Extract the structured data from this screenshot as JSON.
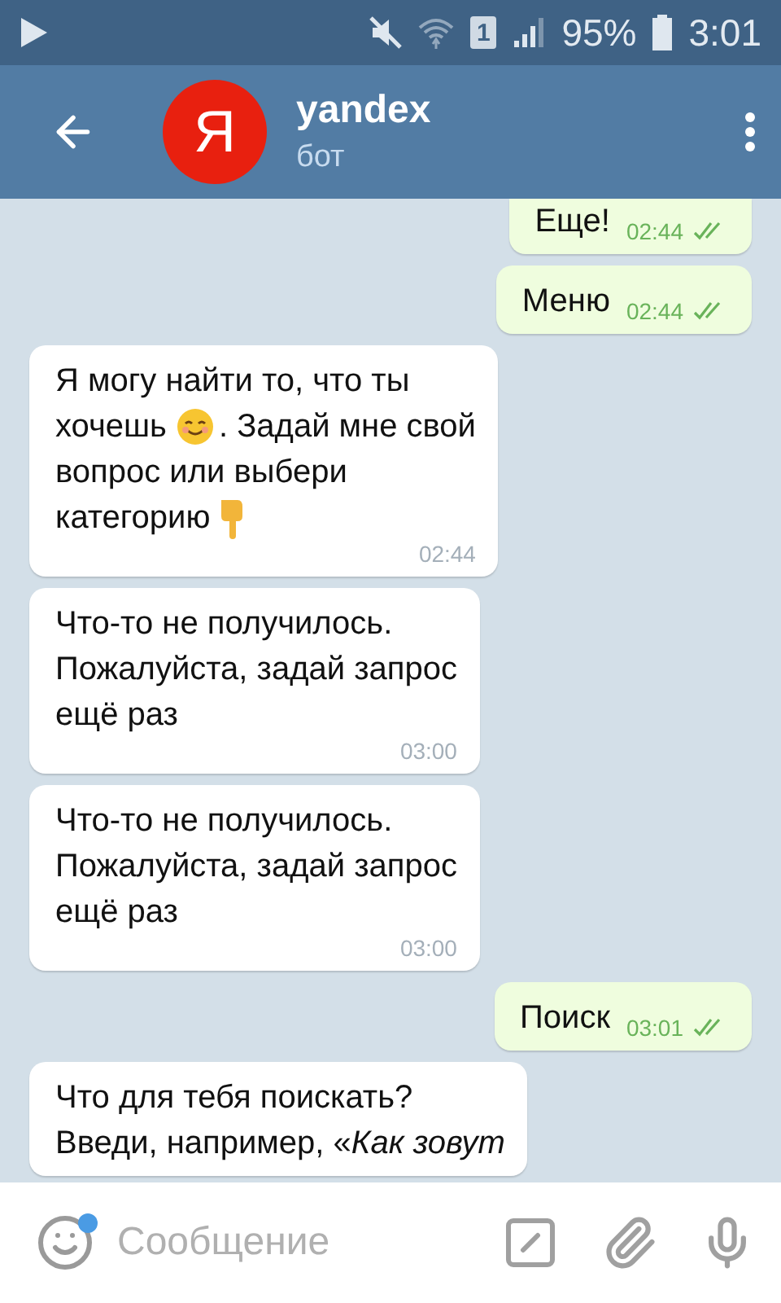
{
  "status_bar": {
    "sim": "1",
    "battery": "95%",
    "time": "3:01"
  },
  "header": {
    "avatar_letter": "Я",
    "title": "yandex",
    "subtitle": "бот"
  },
  "messages": [
    {
      "outgoing": true,
      "cut_top": true,
      "lines": [
        [
          {
            "kind": "text",
            "text": "Еще!"
          }
        ]
      ],
      "time": "02:44"
    },
    {
      "outgoing": true,
      "cut_top": false,
      "lines": [
        [
          {
            "kind": "text",
            "text": "Меню"
          }
        ]
      ],
      "time": "02:44"
    },
    {
      "outgoing": false,
      "cut_top": false,
      "lines": [
        [
          {
            "kind": "text",
            "text": "Я могу найти то, что ты"
          }
        ],
        [
          {
            "kind": "text",
            "text": "хочешь"
          },
          {
            "kind": "smile"
          },
          {
            "kind": "text",
            "text": ". Задай мне свой"
          }
        ],
        [
          {
            "kind": "text",
            "text": "вопрос или выбери"
          }
        ],
        [
          {
            "kind": "text",
            "text": "категорию"
          },
          {
            "kind": "hand"
          }
        ]
      ],
      "time": "02:44"
    },
    {
      "outgoing": false,
      "cut_top": false,
      "lines": [
        [
          {
            "kind": "text",
            "text": "Что-то не получилось."
          }
        ],
        [
          {
            "kind": "text",
            "text": "Пожалуйста, задай запрос"
          }
        ],
        [
          {
            "kind": "text",
            "text": "ещё раз"
          }
        ]
      ],
      "time": "03:00"
    },
    {
      "outgoing": false,
      "cut_top": false,
      "lines": [
        [
          {
            "kind": "text",
            "text": "Что-то не получилось."
          }
        ],
        [
          {
            "kind": "text",
            "text": "Пожалуйста, задай запрос"
          }
        ],
        [
          {
            "kind": "text",
            "text": "ещё раз"
          }
        ]
      ],
      "time": "03:00"
    },
    {
      "outgoing": true,
      "cut_top": false,
      "lines": [
        [
          {
            "kind": "text",
            "text": "Поиск"
          }
        ]
      ],
      "time": "03:01"
    },
    {
      "outgoing": false,
      "cut_top": false,
      "lines": [
        [
          {
            "kind": "text",
            "text": "Что для тебя поискать?"
          }
        ],
        [
          {
            "kind": "text",
            "text": "Введи, например, «*Как зовут*"
          }
        ]
      ]
    }
  ],
  "composer": {
    "placeholder": "Сообщение",
    "emoji_badge": true
  }
}
